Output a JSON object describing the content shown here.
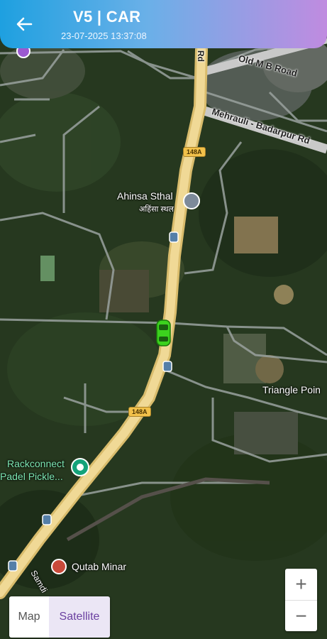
{
  "header": {
    "title": "V5 | CAR",
    "subtitle": "23-07-2025 13:37:08"
  },
  "map": {
    "labels": {
      "old_mb_road": "Old M B Road",
      "mehrauli_road": "Mehrauli - Badarpur Rd",
      "rd_fragment": "Rd",
      "ahinsa_en": "Ahinsa Sthal",
      "ahinsa_hi": "अहिंसा स्थल",
      "triangle": "Triangle Poin",
      "rackconnect_1": "Rackconnect",
      "rackconnect_2": "Padel Pickle...",
      "qutab": "Qutab Minar",
      "samdi": "Samdi"
    },
    "shields": {
      "upper": "148A",
      "lower": "148A"
    }
  },
  "controls": {
    "map_label": "Map",
    "satellite_label": "Satellite",
    "map_type_selected": "Satellite",
    "zoom_in": "+",
    "zoom_out": "−"
  },
  "colors": {
    "header_start": "#1ea0e0",
    "header_end": "#c08be0",
    "main_road": "#e9d08a",
    "car": "#3cd21e"
  }
}
